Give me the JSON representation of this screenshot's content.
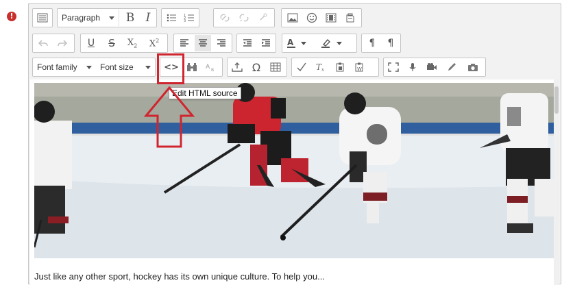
{
  "editor": {
    "block_format": "Paragraph",
    "font_family": "Font family",
    "font_size": "Font size",
    "tooltip": "Edit HTML source",
    "content_text": "Just like any other sport, hockey has its own unique culture. To help you..."
  },
  "colors": {
    "accent_red": "#d0252f",
    "toolbar_bg": "#f2f2f2",
    "alert": "#c9302c"
  },
  "icons": {
    "alert": "!",
    "bold": "B",
    "italic": "I",
    "strike": "S",
    "sub": "X",
    "sub_digit": "2",
    "sup_digit": "2",
    "omega": "Ω",
    "underline": "U",
    "code": "<>",
    "pilcrow": "¶"
  }
}
